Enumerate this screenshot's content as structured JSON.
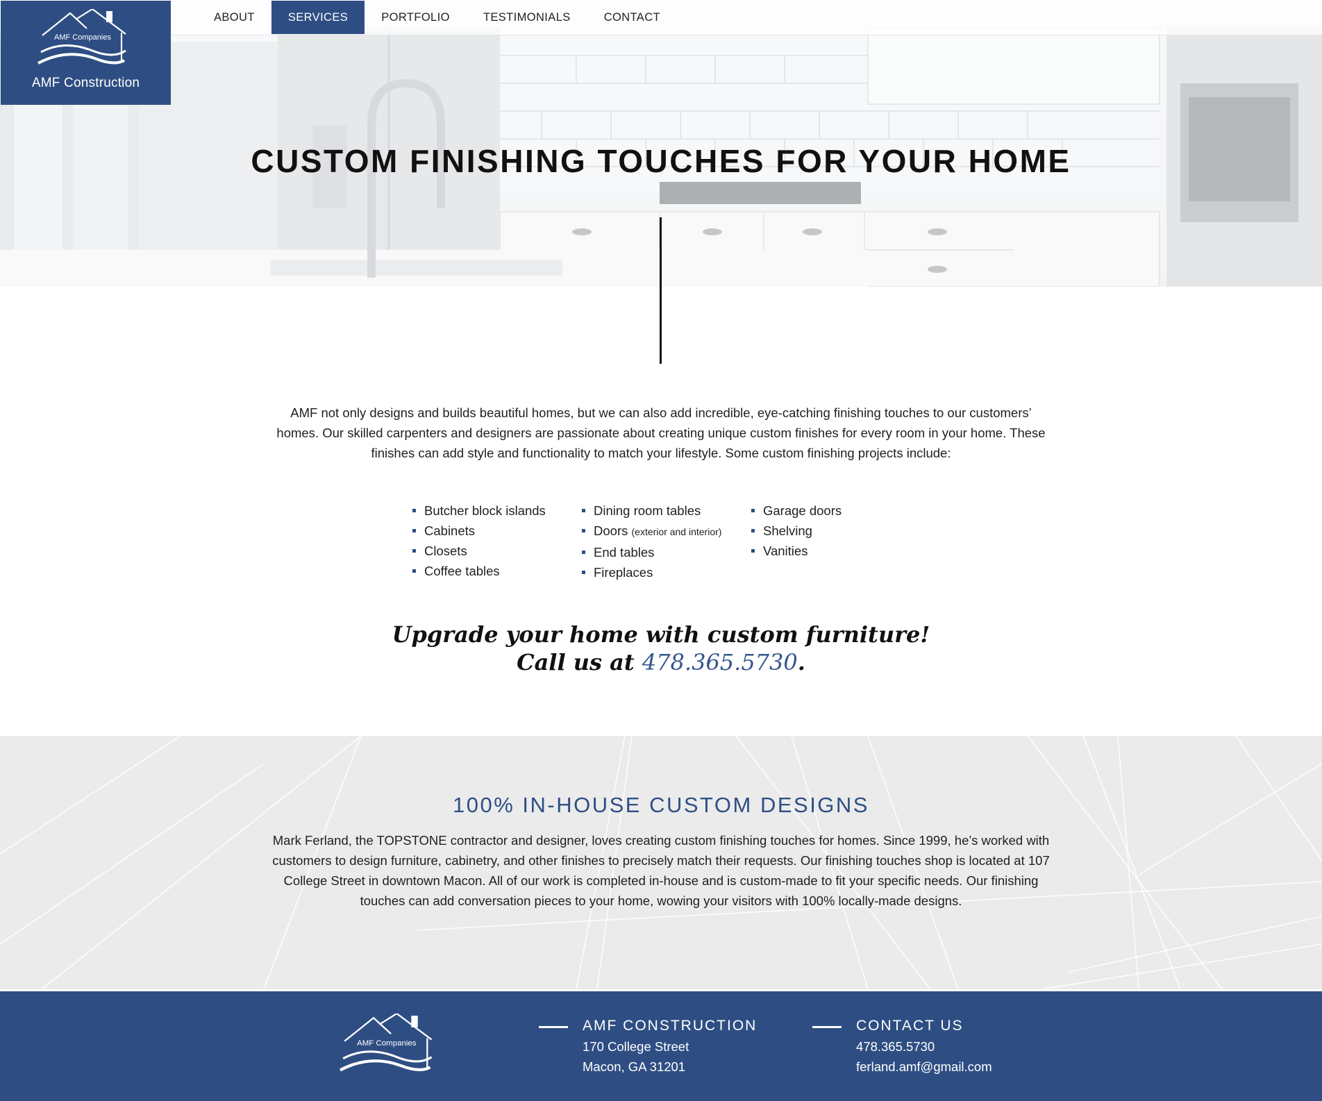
{
  "brand": {
    "logo_text": "AMF Companies",
    "name": "AMF Construction",
    "color_primary": "#2e4e83"
  },
  "nav": {
    "items": [
      "ABOUT",
      "SERVICES",
      "PORTFOLIO",
      "TESTIMONIALS",
      "CONTACT"
    ],
    "active": "SERVICES"
  },
  "hero": {
    "title": "CUSTOM FINISHING TOUCHES FOR YOUR HOME",
    "background": "kitchen-photo"
  },
  "intro": {
    "text": "AMF not only designs and builds beautiful homes, but we can also add incredible, eye-catching finishing touches to our customers’ homes. Our skilled carpenters and designers are passionate about creating unique custom finishes for every room in your home. These finishes can add style and functionality to match your lifestyle. Some custom finishing projects include:"
  },
  "projects": {
    "col1": [
      "Butcher block islands",
      "Cabinets",
      "Closets",
      "Coffee tables"
    ],
    "col2": [
      "Dining room tables",
      "Doors",
      "End tables",
      "Fireplaces"
    ],
    "doors_note": "(exterior and interior)",
    "col3": [
      "Garage doors",
      "Shelving",
      "Vanities"
    ]
  },
  "cta": {
    "line1": "Upgrade your home with custom furniture!",
    "line2_prefix": "Call us at ",
    "phone": "478.365.5730",
    "line2_suffix": "."
  },
  "inhouse": {
    "title": "100% IN-HOUSE CUSTOM DESIGNS",
    "text": "Mark Ferland, the TOPSTONE contractor and designer, loves creating custom finishing touches for homes. Since 1999, he’s worked with customers to design furniture, cabinetry, and other finishes to precisely match their requests. Our finishing touches shop is located at 107 College Street in downtown Macon. All of our work is completed in-house and is custom-made to fit your specific needs. Our finishing touches can add conversation pieces to your home, wowing your visitors with 100% locally-made designs."
  },
  "footer": {
    "logo_text": "AMF Companies",
    "company": {
      "title": "AMF CONSTRUCTION",
      "address1": "170 College Street",
      "address2": "Macon, GA 31201"
    },
    "contact": {
      "title": "CONTACT US",
      "phone": "478.365.5730",
      "email": "ferland.amf@gmail.com"
    }
  }
}
